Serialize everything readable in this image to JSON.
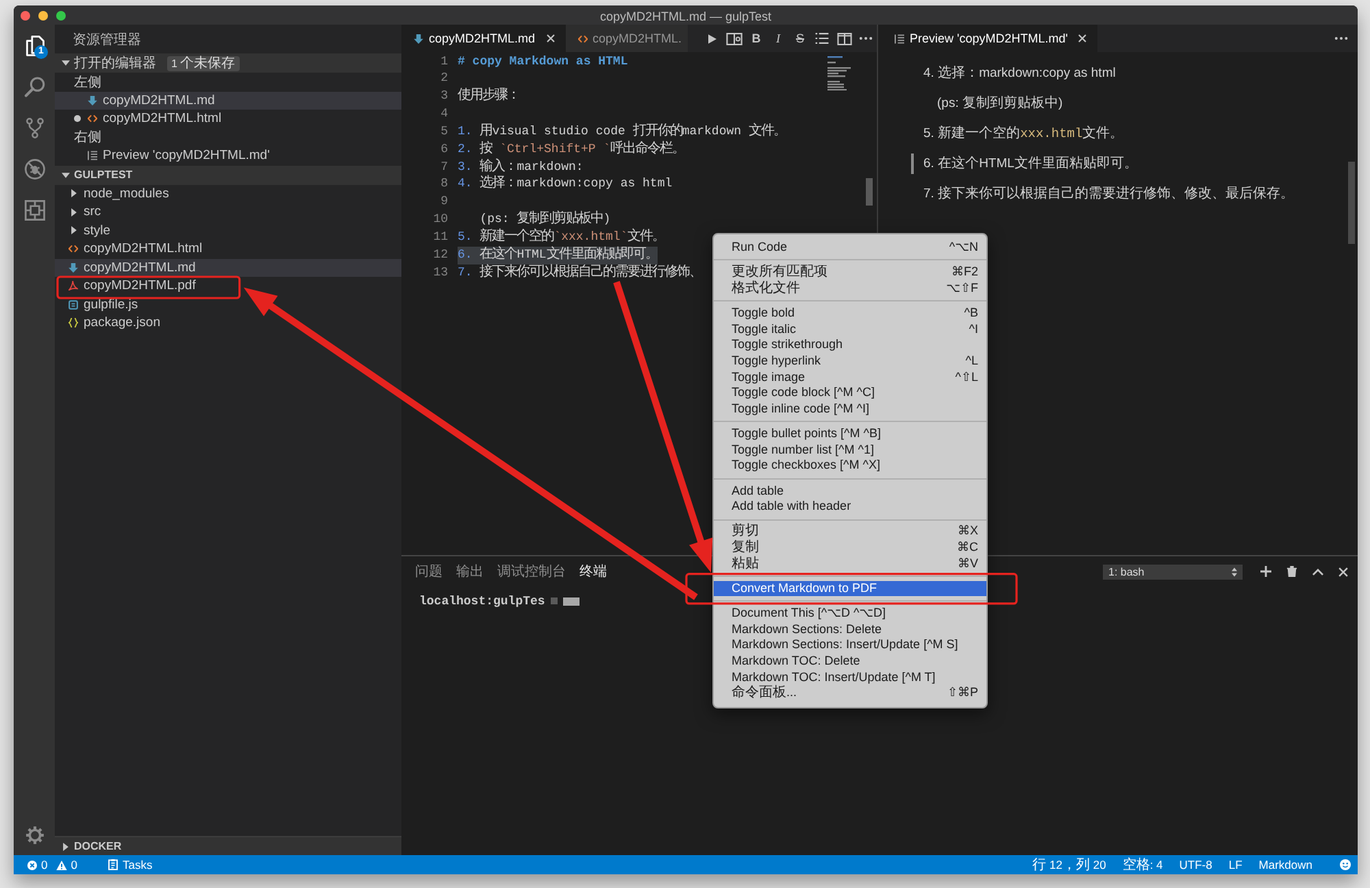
{
  "window": {
    "title": "copyMD2HTML.md — gulpTest"
  },
  "activity_bar": {
    "items": [
      {
        "kind": "explorer",
        "selected": true,
        "badge": "1"
      },
      {
        "kind": "search",
        "selected": false
      },
      {
        "kind": "source-control",
        "selected": false
      },
      {
        "kind": "debug",
        "selected": false
      },
      {
        "kind": "extensions",
        "selected": false
      }
    ],
    "bottom": [
      {
        "kind": "settings"
      }
    ]
  },
  "sidebar": {
    "title": "资源管理器",
    "open_editors": {
      "title": "打开的编辑器",
      "badge": "1 个未保存",
      "expanded": true,
      "groups": [
        {
          "label": "左侧",
          "files": [
            {
              "name": "copyMD2HTML.md",
              "kind": "markdown",
              "selected": true,
              "dirty": false
            },
            {
              "name": "copyMD2HTML.html",
              "kind": "html",
              "selected": false,
              "dirty": true
            }
          ]
        },
        {
          "label": "右侧",
          "files": [
            {
              "name": "Preview 'copyMD2HTML.md'",
              "kind": "preview",
              "selected": false,
              "dirty": false
            }
          ]
        }
      ]
    },
    "folder": {
      "title": "GULPTEST",
      "expanded": true,
      "items": [
        {
          "name": "node_modules",
          "kind": "folder",
          "expanded": false,
          "selected": false,
          "outlined": false,
          "arrow": false
        },
        {
          "name": "src",
          "kind": "folder",
          "expanded": false,
          "selected": false,
          "outlined": false,
          "arrow": false
        },
        {
          "name": "style",
          "kind": "folder",
          "expanded": false,
          "selected": false,
          "outlined": false,
          "arrow": false
        },
        {
          "name": "copyMD2HTML.html",
          "kind": "html",
          "selected": false,
          "outlined": false,
          "arrow": false
        },
        {
          "name": "copyMD2HTML.md",
          "kind": "markdown",
          "selected": true,
          "outlined": false,
          "arrow": false
        },
        {
          "name": "copyMD2HTML.pdf",
          "kind": "pdf",
          "selected": false,
          "outlined": true,
          "arrow": true
        },
        {
          "name": "gulpfile.js",
          "kind": "js",
          "selected": false,
          "outlined": false,
          "arrow": false
        },
        {
          "name": "package.json",
          "kind": "json",
          "selected": false,
          "outlined": false,
          "arrow": false
        }
      ]
    },
    "docker": {
      "title": "DOCKER",
      "expanded": false
    }
  },
  "editor": {
    "tabs": [
      {
        "label": "copyMD2HTML.md",
        "kind": "markdown",
        "selected": true
      },
      {
        "label": "copyMD2HTML.",
        "kind": "html",
        "selected": false
      }
    ],
    "toolbar": [
      {
        "kind": "run"
      },
      {
        "kind": "preview"
      },
      {
        "kind": "bold",
        "glyph": "B"
      },
      {
        "kind": "italic",
        "glyph": "I"
      },
      {
        "kind": "strikethrough",
        "glyph": "S"
      },
      {
        "kind": "list"
      },
      {
        "kind": "split"
      },
      {
        "kind": "more"
      }
    ],
    "lines": [
      {
        "number": "1",
        "selected": false,
        "segments": [
          {
            "kind": "heading",
            "text": "# copy Markdown as HTML"
          }
        ]
      },
      {
        "number": "2",
        "selected": false
      },
      {
        "number": "3",
        "selected": false,
        "segments": [
          {
            "kind": "text",
            "text": "使用步骤："
          }
        ]
      },
      {
        "number": "4",
        "selected": false
      },
      {
        "number": "5",
        "selected": false,
        "segments": [
          {
            "kind": "list",
            "text": "1. "
          },
          {
            "kind": "text",
            "text": "用visual studio code 打开你的markdown 文件。"
          }
        ]
      },
      {
        "number": "6",
        "selected": false,
        "segments": [
          {
            "kind": "list",
            "text": "2. "
          },
          {
            "kind": "text",
            "text": "按 "
          },
          {
            "kind": "code",
            "text": "`Ctrl+Shift+P `"
          },
          {
            "kind": "text",
            "text": "呼出命令栏。"
          }
        ]
      },
      {
        "number": "7",
        "selected": false,
        "segments": [
          {
            "kind": "list",
            "text": "3. "
          },
          {
            "kind": "text",
            "text": "输入：markdown:"
          }
        ]
      },
      {
        "number": "8",
        "selected": false,
        "segments": [
          {
            "kind": "list",
            "text": "4. "
          },
          {
            "kind": "text",
            "text": "选择：markdown:copy as html"
          }
        ]
      },
      {
        "number": "9",
        "selected": false
      },
      {
        "number": "10",
        "selected": false,
        "segments": [
          {
            "kind": "text",
            "text": "   (ps: 复制到剪贴板中)"
          }
        ]
      },
      {
        "number": "11",
        "selected": false,
        "segments": [
          {
            "kind": "list",
            "text": "5. "
          },
          {
            "kind": "text",
            "text": "新建一个空的"
          },
          {
            "kind": "code",
            "text": "`xxx.html`"
          },
          {
            "kind": "text",
            "text": "文件。"
          }
        ]
      },
      {
        "number": "12",
        "selected": true,
        "segments": [
          {
            "kind": "list",
            "text": "6. "
          },
          {
            "kind": "text",
            "text": "在这个HTML文件里面粘贴即可。"
          }
        ]
      },
      {
        "number": "13",
        "selected": false,
        "segments": [
          {
            "kind": "list",
            "text": "7. "
          },
          {
            "kind": "text",
            "text": "接下来你可以根据自己的需要进行修饰、"
          }
        ]
      }
    ]
  },
  "preview": {
    "tab": {
      "label": "Preview 'copyMD2HTML.md'",
      "kind": "preview",
      "selected": true
    },
    "paragraphs": [
      {
        "marked": false,
        "segments": [
          {
            "kind": "text",
            "text": "4. 选择：markdown:copy as html"
          }
        ],
        "children": [
          {
            "marked": false,
            "segments": [
              {
                "kind": "text",
                "text": "(ps: 复制到剪贴板中)"
              }
            ]
          }
        ]
      },
      {
        "marked": false,
        "segments": [
          {
            "kind": "text",
            "text": "5. 新建一个空的"
          },
          {
            "kind": "code",
            "text": "xxx.html"
          },
          {
            "kind": "text",
            "text": "文件。"
          }
        ]
      },
      {
        "marked": true,
        "segments": [
          {
            "kind": "text",
            "text": "6. 在这个HTML文件里面粘贴即可。"
          }
        ]
      },
      {
        "marked": false,
        "segments": [
          {
            "kind": "text",
            "text": "7. 接下来你可以根据自己的需要进行修饰、修改、最后保存。"
          }
        ]
      }
    ]
  },
  "panel": {
    "tabs": [
      {
        "label": "问题",
        "selected": false
      },
      {
        "label": "输出",
        "selected": false
      },
      {
        "label": "调试控制台",
        "selected": false
      },
      {
        "label": "终端",
        "selected": true
      }
    ],
    "terminal": {
      "shell": "1: bash",
      "lines": [
        "localhost:gulpTes"
      ]
    },
    "actions": [
      {
        "kind": "add"
      },
      {
        "kind": "delete"
      },
      {
        "kind": "maximize"
      },
      {
        "kind": "close"
      }
    ]
  },
  "context_menu": {
    "groups": [
      {
        "items": [
          {
            "label": "Run Code",
            "shortcut": "^⌥N",
            "selected": false,
            "outlined": false,
            "arrow": false
          }
        ]
      },
      {
        "items": [
          {
            "label": "更改所有匹配项",
            "shortcut": "⌘F2",
            "selected": false,
            "outlined": false,
            "arrow": false
          },
          {
            "label": "格式化文件",
            "shortcut": "⌥⇧F",
            "selected": false,
            "outlined": false,
            "arrow": false
          }
        ]
      },
      {
        "items": [
          {
            "label": "Toggle bold",
            "shortcut": "^B",
            "selected": false,
            "outlined": false,
            "arrow": false
          },
          {
            "label": "Toggle italic",
            "shortcut": "^I",
            "selected": false,
            "outlined": false,
            "arrow": false
          },
          {
            "label": "Toggle strikethrough",
            "selected": false,
            "outlined": false,
            "arrow": false
          },
          {
            "label": "Toggle hyperlink",
            "shortcut": "^L",
            "selected": false,
            "outlined": false,
            "arrow": false
          },
          {
            "label": "Toggle image",
            "shortcut": "^⇧L",
            "selected": false,
            "outlined": false,
            "arrow": false
          },
          {
            "label": "Toggle code block [^M ^C]",
            "selected": false,
            "outlined": false,
            "arrow": false
          },
          {
            "label": "Toggle inline code [^M ^I]",
            "selected": false,
            "outlined": false,
            "arrow": false
          }
        ]
      },
      {
        "items": [
          {
            "label": "Toggle bullet points [^M ^B]",
            "selected": false,
            "outlined": false,
            "arrow": false
          },
          {
            "label": "Toggle number list [^M ^1]",
            "selected": false,
            "outlined": false,
            "arrow": false
          },
          {
            "label": "Toggle checkboxes [^M ^X]",
            "selected": false,
            "outlined": false,
            "arrow": false
          }
        ]
      },
      {
        "items": [
          {
            "label": "Add table",
            "selected": false,
            "outlined": false,
            "arrow": false
          },
          {
            "label": "Add table with header",
            "selected": false,
            "outlined": false,
            "arrow": false
          }
        ]
      },
      {
        "items": [
          {
            "label": "剪切",
            "shortcut": "⌘X",
            "selected": false,
            "outlined": false,
            "arrow": false
          },
          {
            "label": "复制",
            "shortcut": "⌘C",
            "selected": false,
            "outlined": false,
            "arrow": false
          },
          {
            "label": "粘贴",
            "shortcut": "⌘V",
            "selected": false,
            "outlined": false,
            "arrow": false
          }
        ]
      },
      {
        "items": [
          {
            "label": "Convert Markdown to PDF",
            "selected": true,
            "outlined": true,
            "arrow": true
          }
        ]
      },
      {
        "items": [
          {
            "label": "Document This [^⌥D ^⌥D]",
            "selected": false,
            "outlined": false,
            "arrow": false
          },
          {
            "label": "Markdown Sections: Delete",
            "selected": false,
            "outlined": false,
            "arrow": false
          },
          {
            "label": "Markdown Sections: Insert/Update [^M S]",
            "selected": false,
            "outlined": false,
            "arrow": false
          },
          {
            "label": "Markdown TOC: Delete",
            "selected": false,
            "outlined": false,
            "arrow": false
          },
          {
            "label": "Markdown TOC: Insert/Update [^M T]",
            "selected": false,
            "outlined": false,
            "arrow": false
          },
          {
            "label": "命令面板...",
            "shortcut": "⇧⌘P",
            "selected": false,
            "outlined": false,
            "arrow": false
          }
        ]
      }
    ]
  },
  "status_bar": {
    "errors": "0",
    "warnings": "0",
    "tasks": "Tasks",
    "items": [
      "行 12，列 20",
      "空格: 4",
      "UTF-8",
      "LF",
      "Markdown"
    ]
  }
}
